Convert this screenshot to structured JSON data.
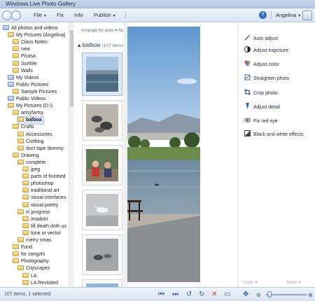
{
  "window": {
    "title": "Windows Live Photo Gallery"
  },
  "toolbar": {
    "file": "File",
    "fix": "Fix",
    "info": "Info",
    "publish": "Publish",
    "more": "⋮",
    "account": "Angelina"
  },
  "tree": {
    "items": [
      "All photos and videos",
      "My Pictures (Angelina)",
      "Class Notes",
      "new",
      "Picasa",
      "SortMe",
      "Walls",
      "My Videos",
      "Public Pictures",
      "Sample Pictures",
      "Public Videos",
      "My Pictures (D:\\)",
      "artsyfartsy",
      "balboa",
      "Crafts",
      "Accessories",
      "Clothing",
      "duct tape dummy",
      "Drawing",
      "complete",
      "jpeg",
      "parts of finished",
      "photoshop",
      "traditional art",
      "visual interfaces",
      "visual poetry",
      "in progress",
      "imadoki",
      "till death doth us",
      "tone or vector",
      "merry xmas",
      "Food",
      "for zongzhi",
      "Photography",
      "Cityscapes",
      "LA",
      "LA Revisited"
    ],
    "selected": "balboa"
  },
  "gallery": {
    "arrange": "Arrange by auto ▾  Au",
    "group_name": "balboa",
    "group_count": "(107 items,"
  },
  "fixes": [
    {
      "label": "Auto adjust",
      "icon": "wand-icon"
    },
    {
      "label": "Adjust exposure",
      "icon": "exposure-icon"
    },
    {
      "label": "Adjust color",
      "icon": "color-icon"
    },
    {
      "label": "Straighten photo",
      "icon": "straighten-icon"
    },
    {
      "label": "Crop photo",
      "icon": "crop-icon"
    },
    {
      "label": "Adjust detail",
      "icon": "detail-icon"
    },
    {
      "label": "Fix red eye",
      "icon": "red-eye-icon"
    },
    {
      "label": "Black and white effects",
      "icon": "bw-icon"
    }
  ],
  "undo": {
    "undo": "Undo ▾",
    "redo": "Redo ▾"
  },
  "status": {
    "text": "107 items, 1 selected"
  },
  "colors": {
    "accent": "#2a5da8",
    "selection": "#dbe8f8"
  }
}
